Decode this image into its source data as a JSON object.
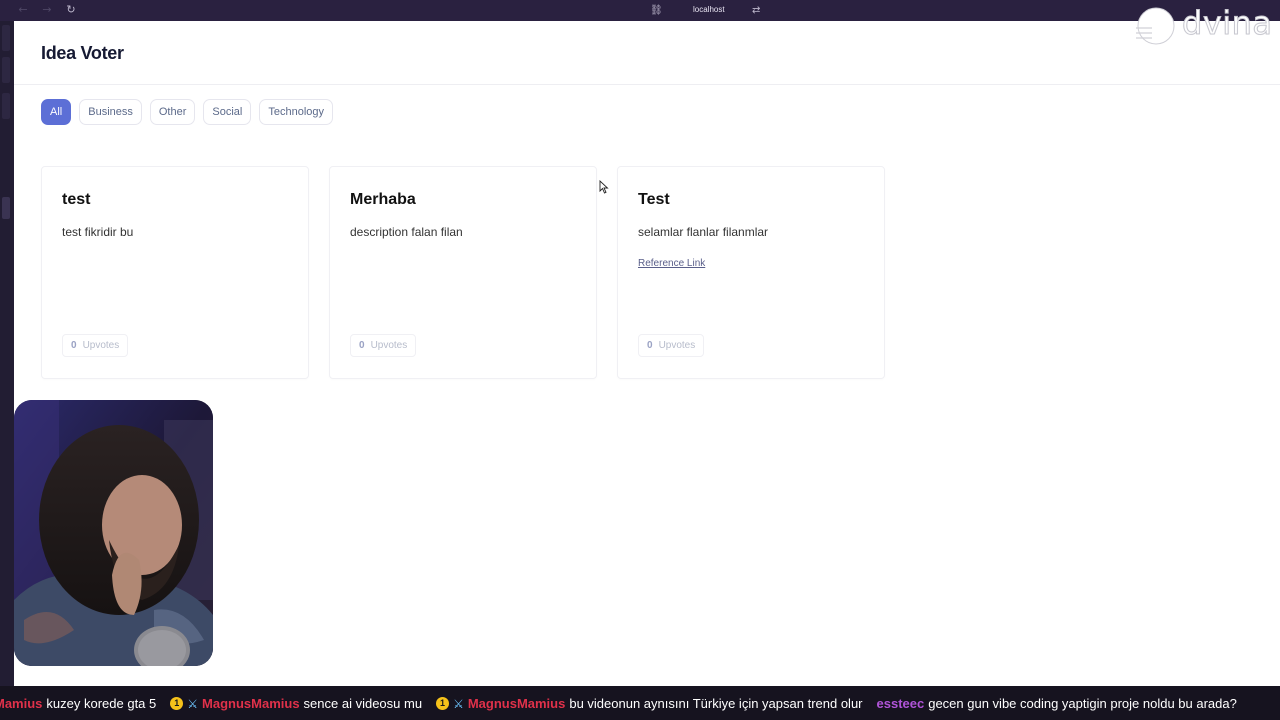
{
  "browser": {
    "url": "localhost",
    "back_icon": "arrow-left-icon",
    "forward_icon": "arrow-right-icon",
    "reload_icon": "reload-icon"
  },
  "app": {
    "title": "Idea Voter",
    "accent_color": "#5c6fd6"
  },
  "filters": [
    {
      "label": "All",
      "active": true
    },
    {
      "label": "Business",
      "active": false
    },
    {
      "label": "Other",
      "active": false
    },
    {
      "label": "Social",
      "active": false
    },
    {
      "label": "Technology",
      "active": false
    }
  ],
  "ideas": [
    {
      "title": "test",
      "description": "test fikridir bu",
      "link": "",
      "upvote_count": "0",
      "upvote_label": "Upvotes"
    },
    {
      "title": "Merhaba",
      "description": "description falan filan",
      "link": "",
      "upvote_count": "0",
      "upvote_label": "Upvotes"
    },
    {
      "title": "Test",
      "description": "selamlar flanlar filanmlar",
      "link": "Reference Link",
      "upvote_count": "0",
      "upvote_label": "Upvotes"
    }
  ],
  "logo": {
    "text": "dvina"
  },
  "chat": [
    {
      "user": "Mamius",
      "user_color": "#e0314a",
      "badges": false,
      "text": "kuzey korede gta 5"
    },
    {
      "user": "MagnusMamius",
      "user_color": "#e0314a",
      "badges": true,
      "text": "sence ai videosu mu"
    },
    {
      "user": "MagnusMamius",
      "user_color": "#e0314a",
      "badges": true,
      "text": "bu videonun aynısını Türkiye için yapsan trend olur"
    },
    {
      "user": "essteec",
      "user_color": "#b054d8",
      "badges": false,
      "text": "gecen gun vibe coding yaptigin proje noldu bu arada?"
    }
  ],
  "badge_glyph": "1"
}
